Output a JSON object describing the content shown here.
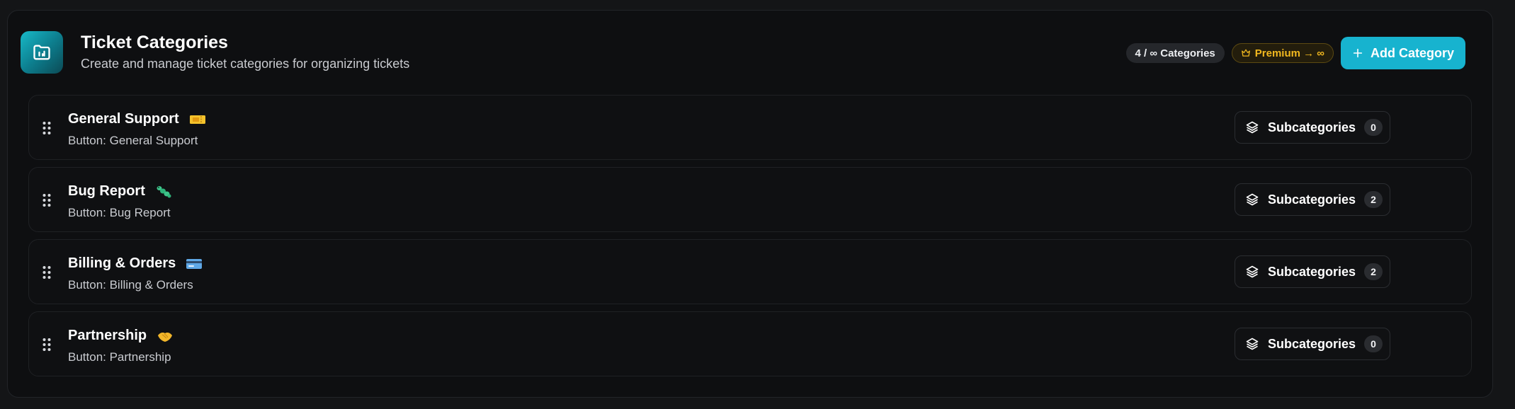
{
  "header": {
    "title": "Ticket Categories",
    "subtitle": "Create and manage ticket categories for organizing tickets",
    "count_pill": "4 / ∞ Categories",
    "premium_pill": "Premium → ∞",
    "add_button": "Add Category",
    "icon": "folder-chart-icon",
    "accent_color": "#17b3cf",
    "premium_color": "#f1b81f"
  },
  "categories": [
    {
      "name": "General Support",
      "emoji": "ticket-icon",
      "button": "Button: General Support",
      "sub_label": "Subcategories",
      "sub_count": "0"
    },
    {
      "name": "Bug Report",
      "emoji": "bug-icon",
      "button": "Button: Bug Report",
      "sub_label": "Subcategories",
      "sub_count": "2"
    },
    {
      "name": "Billing & Orders",
      "emoji": "credit-card-icon",
      "button": "Button: Billing & Orders",
      "sub_label": "Subcategories",
      "sub_count": "2"
    },
    {
      "name": "Partnership",
      "emoji": "handshake-icon",
      "button": "Button: Partnership",
      "sub_label": "Subcategories",
      "sub_count": "0"
    }
  ]
}
